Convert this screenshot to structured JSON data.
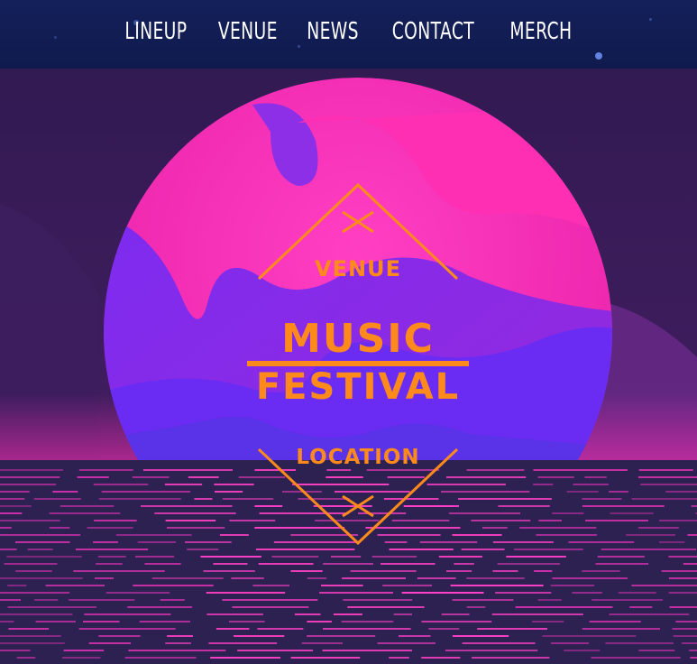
{
  "nav": {
    "items": [
      {
        "label": "LINEUP"
      },
      {
        "label": "VENUE"
      },
      {
        "label": "NEWS"
      },
      {
        "label": "CONTACT"
      },
      {
        "label": "MERCH"
      }
    ]
  },
  "poster": {
    "venue": "VENUE",
    "line1": "MUSIC",
    "line2": "FESTIVAL",
    "location": "LOCATION"
  },
  "colors": {
    "nav_bg": "#12205a",
    "accent_orange": "#ff8a1c",
    "sun_pink": "#ff2fb4",
    "sun_purple": "#8a2cf0",
    "sea": "#2a1f4e",
    "lines": "#ff35c4"
  }
}
